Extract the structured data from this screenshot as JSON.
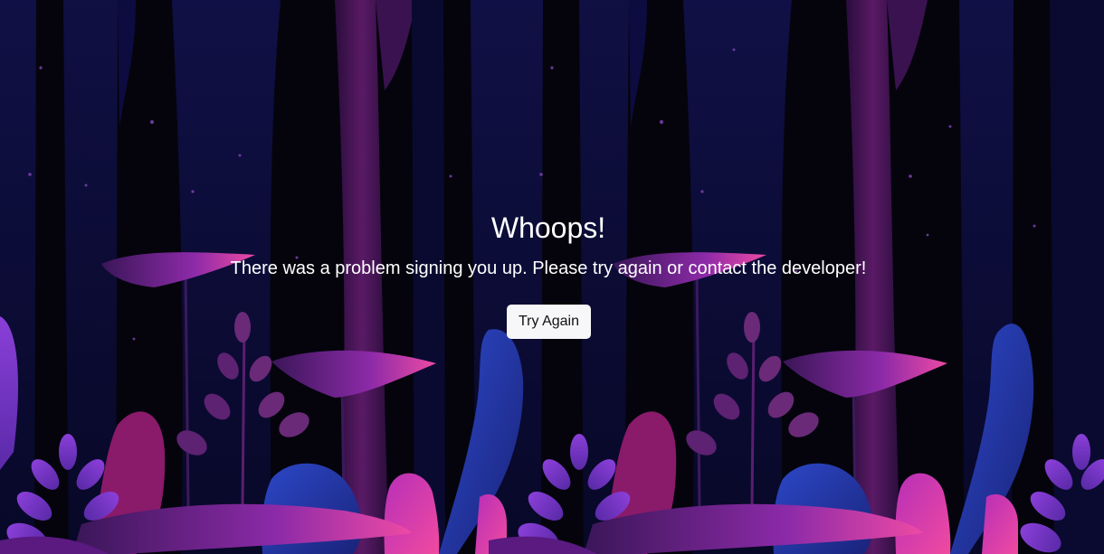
{
  "error": {
    "title": "Whoops!",
    "message": "There was a problem signing you up. Please try again or contact the developer!",
    "button_label": "Try Again"
  },
  "theme": {
    "background": "#05040d",
    "trunk_dark": "#0d0b3a",
    "trunk_purple": "#4a1456",
    "leaf_magenta": "#e0399e",
    "leaf_violet": "#7a36c8",
    "leaf_blue": "#2a3fb8",
    "button_bg": "#f7f7fa",
    "text": "#ffffff"
  }
}
